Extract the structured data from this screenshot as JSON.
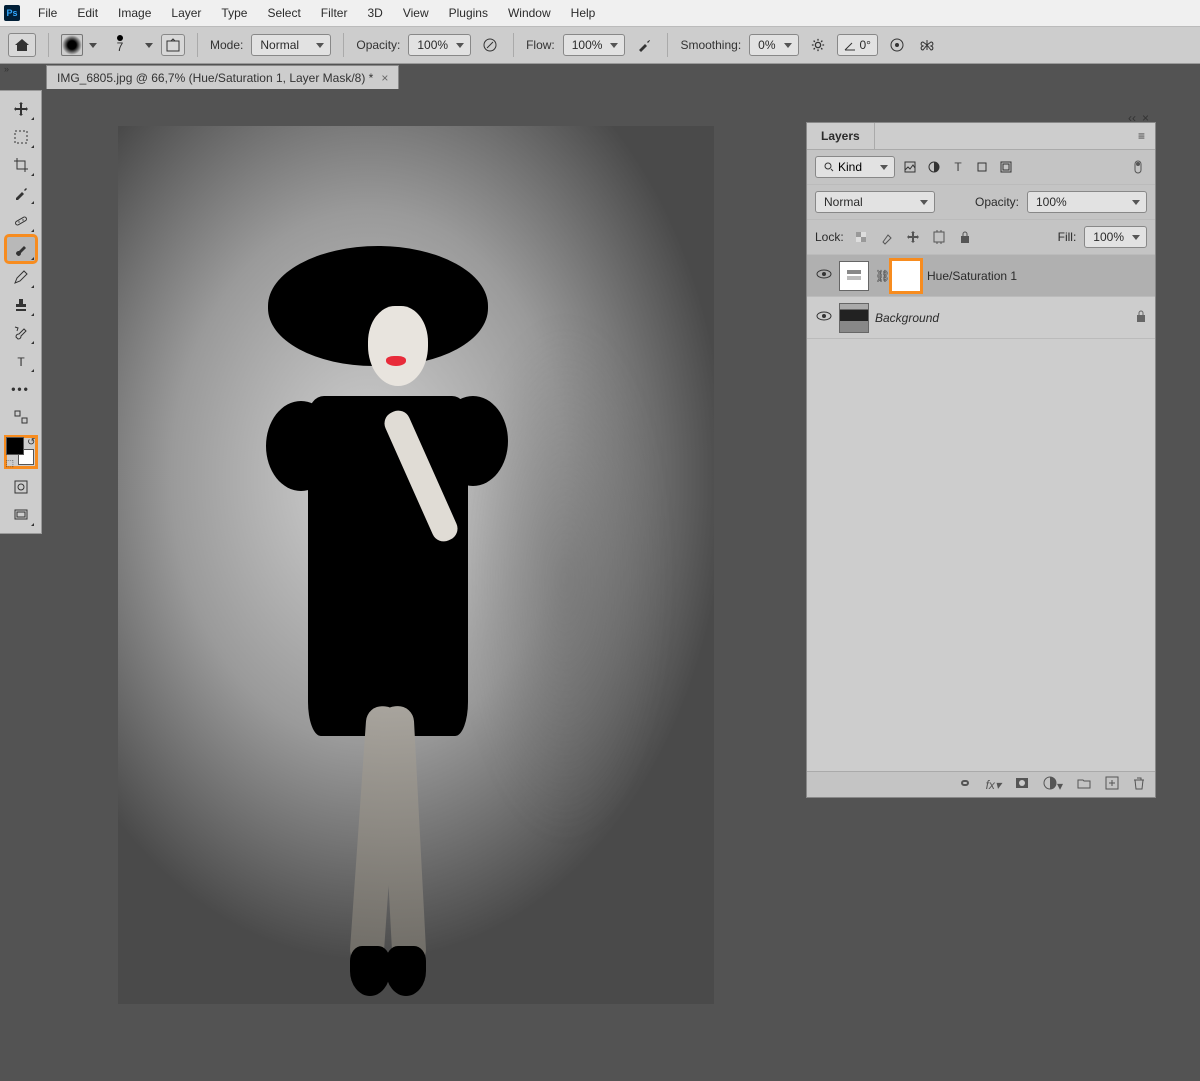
{
  "menu": {
    "file": "File",
    "edit": "Edit",
    "image": "Image",
    "layer": "Layer",
    "type": "Type",
    "select": "Select",
    "filter": "Filter",
    "threeD": "3D",
    "view": "View",
    "plugins": "Plugins",
    "window": "Window",
    "help": "Help",
    "ps": "Ps"
  },
  "options": {
    "brush_size": "7",
    "mode_label": "Mode:",
    "mode_value": "Normal",
    "opacity_label": "Opacity:",
    "opacity_value": "100%",
    "flow_label": "Flow:",
    "flow_value": "100%",
    "smoothing_label": "Smoothing:",
    "smoothing_value": "0%",
    "angle_value": "0°"
  },
  "tab": {
    "title": "IMG_6805.jpg @ 66,7% (Hue/Saturation 1, Layer Mask/8) *"
  },
  "layers_panel": {
    "tab": "Layers",
    "filter_kind": "Kind",
    "blend_mode": "Normal",
    "opacity_label": "Opacity:",
    "opacity_value": "100%",
    "lock_label": "Lock:",
    "fill_label": "Fill:",
    "fill_value": "100%",
    "layers": [
      {
        "name": "Hue/Saturation 1",
        "eye": true,
        "mask": true,
        "selected": true,
        "adj": true
      },
      {
        "name": "Background",
        "eye": true,
        "locked": true,
        "adj": false
      }
    ],
    "foot_icons": [
      "link",
      "fx",
      "mask",
      "adj",
      "group",
      "new",
      "trash"
    ]
  },
  "tools": [
    "move",
    "marquee",
    "crop",
    "eyedropper",
    "healing",
    "brush",
    "mixer-brush",
    "stamp",
    "history-brush",
    "type",
    "more",
    "edit-toolbar"
  ]
}
